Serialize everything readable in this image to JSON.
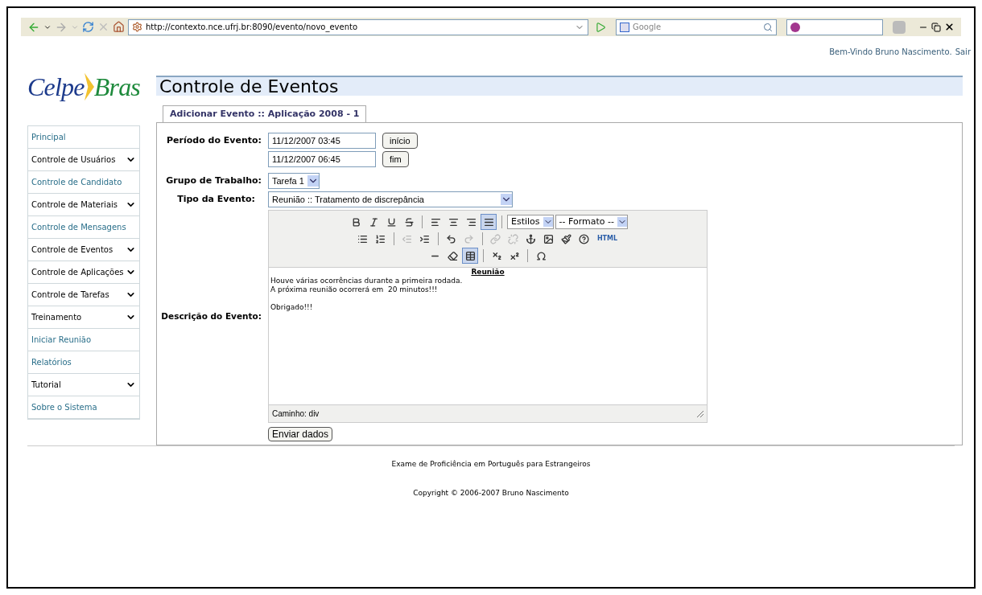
{
  "browser": {
    "url": "http://contexto.nce.ufrj.br:8090/evento/novo_evento",
    "search_placeholder": "Google"
  },
  "header": {
    "welcome": "Bem-Vindo Bruno Nascimento.",
    "logout": "Sair",
    "logo_left": "Celpe",
    "logo_right": "Bras",
    "title": "Controle de Eventos"
  },
  "sidebar": {
    "items": [
      {
        "label": "Principal",
        "expandable": false
      },
      {
        "label": "Controle de Usuários",
        "expandable": true
      },
      {
        "label": "Controle de Candidato",
        "expandable": false
      },
      {
        "label": "Controle de Materiais",
        "expandable": true
      },
      {
        "label": "Controle de Mensagens",
        "expandable": false
      },
      {
        "label": "Controle de Eventos",
        "expandable": true
      },
      {
        "label": "Controle de Aplicações",
        "expandable": true
      },
      {
        "label": "Controle de Tarefas",
        "expandable": true
      },
      {
        "label": "Treinamento",
        "expandable": true
      },
      {
        "label": "Iniciar Reunião",
        "expandable": false
      },
      {
        "label": "Relatórios",
        "expandable": false
      },
      {
        "label": "Tutorial",
        "expandable": true
      },
      {
        "label": "Sobre o Sistema",
        "expandable": false
      }
    ]
  },
  "tabs": [
    {
      "label": "Adicionar Evento :: Aplicação 2008 - 1",
      "selected": true
    }
  ],
  "form": {
    "period_label": "Período do Evento:",
    "start_value": "11/12/2007 03:45",
    "start_button": "início",
    "end_value": "11/12/2007 06:45",
    "end_button": "fim",
    "group_label": "Grupo de Trabalho:",
    "group_value": "Tarefa 1",
    "type_label": "Tipo da Evento:",
    "type_value": "Reunião :: Tratamento de discrepância",
    "description_label": "Descrição do Evento:",
    "submit": "Enviar dados"
  },
  "editor": {
    "toolbar_rows": [
      [
        {
          "kind": "bold",
          "pressed": false,
          "disabled": false
        },
        {
          "kind": "italic",
          "pressed": false,
          "disabled": false
        },
        {
          "kind": "underline",
          "pressed": false,
          "disabled": false
        },
        {
          "kind": "strike",
          "pressed": false,
          "disabled": false
        },
        {
          "kind": "separator"
        },
        {
          "kind": "left",
          "pressed": false,
          "disabled": false
        },
        {
          "kind": "center",
          "pressed": false,
          "disabled": false
        },
        {
          "kind": "right",
          "pressed": false,
          "disabled": false
        },
        {
          "kind": "justify",
          "pressed": true,
          "disabled": false
        },
        {
          "kind": "separator"
        },
        {
          "kind": "select",
          "value": "Estilos"
        },
        {
          "kind": "select",
          "value": "-- Formato --"
        }
      ],
      [
        {
          "kind": "bullets",
          "pressed": false,
          "disabled": false
        },
        {
          "kind": "numbers",
          "pressed": false,
          "disabled": false
        },
        {
          "kind": "separator"
        },
        {
          "kind": "outdent",
          "pressed": false,
          "disabled": true
        },
        {
          "kind": "indent",
          "pressed": false,
          "disabled": false
        },
        {
          "kind": "separator"
        },
        {
          "kind": "undo",
          "pressed": false,
          "disabled": false
        },
        {
          "kind": "redo",
          "pressed": false,
          "disabled": true
        },
        {
          "kind": "separator"
        },
        {
          "kind": "link",
          "pressed": false,
          "disabled": true
        },
        {
          "kind": "unlink",
          "pressed": false,
          "disabled": true
        },
        {
          "kind": "anchor",
          "pressed": false,
          "disabled": false
        },
        {
          "kind": "image",
          "pressed": false,
          "disabled": false
        },
        {
          "kind": "cleanup",
          "pressed": false,
          "disabled": false
        },
        {
          "kind": "help",
          "pressed": false,
          "disabled": false
        },
        {
          "kind": "html",
          "label": "HTML"
        }
      ],
      [
        {
          "kind": "rule",
          "pressed": false,
          "disabled": false
        },
        {
          "kind": "eraser",
          "pressed": false,
          "disabled": false
        },
        {
          "kind": "table",
          "pressed": true,
          "disabled": false
        },
        {
          "kind": "separator"
        },
        {
          "kind": "subscript",
          "pressed": false,
          "disabled": false
        },
        {
          "kind": "superscript",
          "pressed": false,
          "disabled": false
        },
        {
          "kind": "separator"
        },
        {
          "kind": "omega",
          "pressed": false,
          "disabled": false
        }
      ]
    ],
    "heading": "Reunião",
    "paragraphs": [
      [
        "Houve várias ocorrências durante a primeira rodada.",
        "A próxima reunião ocorrerá em  20 minutos!!!"
      ],
      [
        "Obrigado!!!"
      ]
    ],
    "path": "Caminho: div"
  },
  "footer": {
    "line1": "Exame de Proficiência em Português para Estrangeiros",
    "line2": "Copyright © 2006-2007 Bruno Nascimento"
  }
}
